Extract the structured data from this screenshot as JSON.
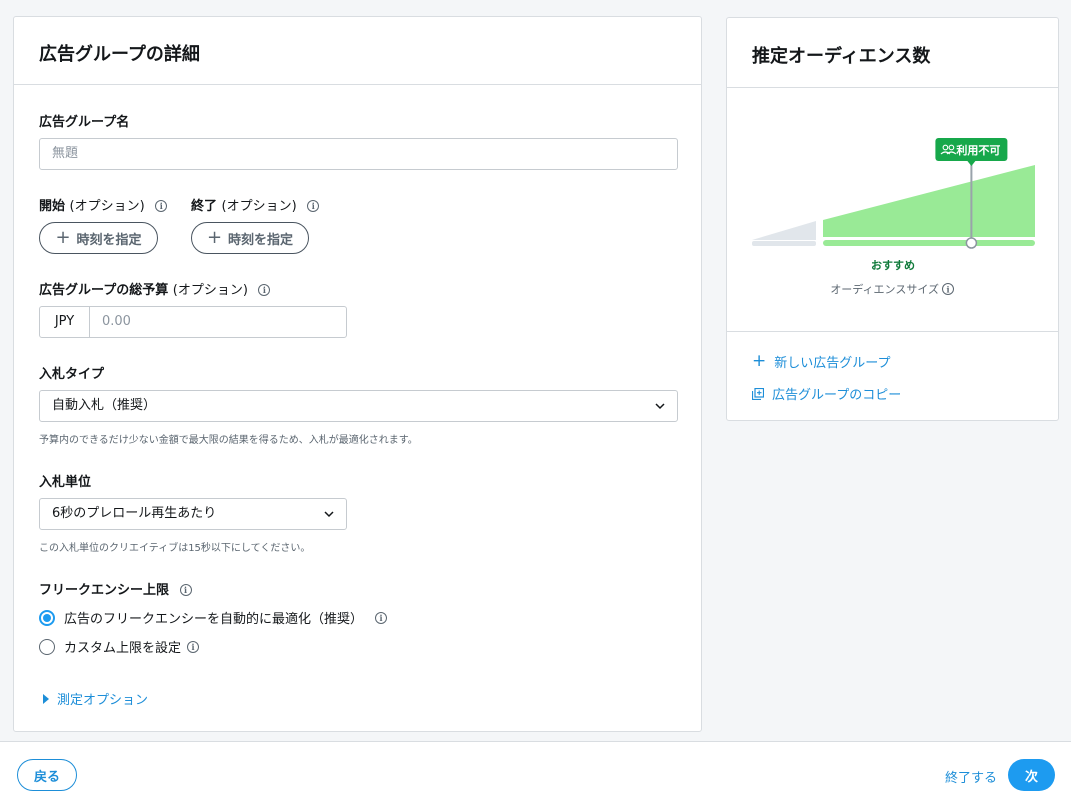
{
  "ad_group": {
    "title": "広告グループの詳細",
    "name_label": "広告グループ名",
    "name_placeholder": "無題",
    "start_label": "開始",
    "start_optional": "(オプション)",
    "end_label": "終了",
    "end_optional": "(オプション)",
    "set_time_label": "時刻を指定",
    "budget_label": "広告グループの総予算",
    "budget_optional": "(オプション)",
    "currency": "JPY",
    "budget_placeholder": "0.00",
    "bid_type_label": "入札タイプ",
    "bid_type_value": "自動入札（推奨）",
    "bid_type_help": "予算内のできるだけ少ない金額で最大限の結果を得るため、入札が最適化されます。",
    "bid_unit_label": "入札単位",
    "bid_unit_value": "6秒のプレロール再生あたり",
    "bid_unit_help": "この入札単位のクリエイティブは15秒以下にしてください。",
    "frequency_label": "フリークエンシー上限",
    "frequency_options": [
      {
        "label": "広告のフリークエンシーを自動的に最適化（推奨）",
        "selected": true
      },
      {
        "label": "カスタム上限を設定",
        "selected": false
      }
    ],
    "measurement_label": "測定オプション"
  },
  "audience": {
    "title": "推定オーディエンス数",
    "status_badge": "利用不可",
    "recommended_label": "おすすめ",
    "size_label": "オーディエンスサイズ",
    "marker_position": 0.7,
    "recommended_color": "#99ea96",
    "low_color": "#e1e6eb",
    "badge_color": "#17a84b",
    "new_ad_group": "新しい広告グループ",
    "copy_ad_group": "広告グループのコピー"
  },
  "footer": {
    "back": "戻る",
    "finish": "終了する",
    "next": "次"
  },
  "info_glyph": "i"
}
